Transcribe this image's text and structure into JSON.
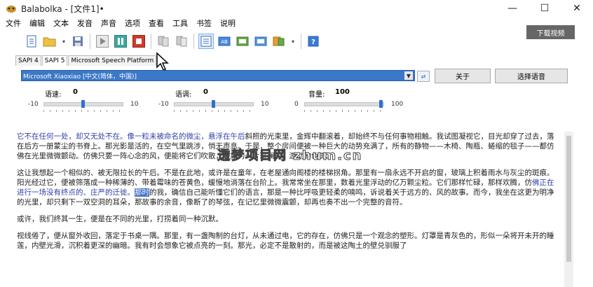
{
  "window": {
    "title": "Balabolka - [文件1]•",
    "minimize": "—",
    "maximize": "☐",
    "close": "✕"
  },
  "menu": [
    "文件",
    "编辑",
    "文本",
    "发音",
    "声音",
    "选项",
    "查看",
    "工具",
    "书签",
    "说明"
  ],
  "download_button": "下载视频",
  "toolbar_icons": [
    "new-file-icon",
    "open-folder-icon",
    "save-icon",
    "play-icon",
    "pause-icon",
    "stop-icon",
    "read-clipboard-icon",
    "read-file-icon",
    "settings-icon",
    "dictionary-icon",
    "speech-icon",
    "convert-icon",
    "voice-icon",
    "help-icon"
  ],
  "tabs": [
    "SAPI 4",
    "SAPI 5",
    "Microsoft Speech Platform"
  ],
  "voice": {
    "selected": "Microsoft Xiaoxiao [中文(简体，中国)]",
    "about_label": "关于",
    "choose_label": "选择语音"
  },
  "sliders": {
    "rate": {
      "label": "语速:",
      "value": "0",
      "min": "-10",
      "max": "10",
      "level": 0.5
    },
    "pitch": {
      "label": "语调:",
      "value": "0",
      "min": "-10",
      "max": "10",
      "level": 0.5
    },
    "volume": {
      "label": "音量:",
      "value": "100",
      "min": "0",
      "max": "100",
      "level": 1.0
    }
  },
  "watermark": "透梦项目网 zhum.cn",
  "text": {
    "p1_a": "它不在任何一处，却又无处不在。",
    "p1_b": "像一粒未被命名的微尘，悬浮在午后",
    "p1_c": "斜照的光束里，金辉中翻滚着，却始终不与任何事物相触。我试图凝视它，目光却穿了过去，落在后方一册蒙尘的书脊上。那光影是活的，在空气里跳涉，悄无声息。于是，整个房间便被一种巨大的动势充满了，所有的静物——木椅、陶瓶、蜷缩的毯子——都仿佛在光里微微颤动。仿佛只要一阵心念的风，便能将它们吹散，还原为一片斑斓的、游动的色斑。",
    "p2_a": "这让我想起一个相似的、被无限拉长的午后。不是在此地，或许是在童年，在老屋通向阁楼的楼梯拐角。那里有一扇永远不开启的窗，玻璃上积着雨水与灰尘的斑痕。阳光经过它，便被筛落成一种稀薄的、带着霉味的苍黄色，缓慢地淌落在台阶上。我常常坐在那里，数着光里浮动的亿万颗尘粒。它们那样忙碌，那样欢腾，仿",
    "p2_b": "佛正在进行一场没有终点的、庄严的迁徙。",
    "p2_sel": "那时",
    "p2_c": "的我，确信自己能听懂它们的语言，那是一种比呼吸更轻柔的喃鸣，诉说着关于远方的、风的故事。而今，我坐在这更为明净的光里，却只剩下一双空洞的耳朵，那故事的余音，像断了的琴弦，在记忆里微微震颤，却再也奏不出一个完整的音符。",
    "p3": "或许，我们终其一生，便是在不同的光里，打捞着同一种沉默。",
    "p4": "视线倦了，便从窗外收回，落定于书桌一隅。那里，有一盏陶制的台灯，从未通过电，它的存在，仿佛只是一个观念的塑形。灯罩是青灰色的，形似一朵将开未开的睡莲，内壁光滑，沉积着更深的幽暗。我有时会想象它被点亮的一刻。那光，必定不是散射的，而是被这陶土的壁兑驯服了"
  },
  "colors": {
    "accent": "#2f3fa8",
    "selection": "#3f6fc8",
    "voice_bg": "#3a78c8",
    "slider_thumb": "#2f6fd0"
  }
}
